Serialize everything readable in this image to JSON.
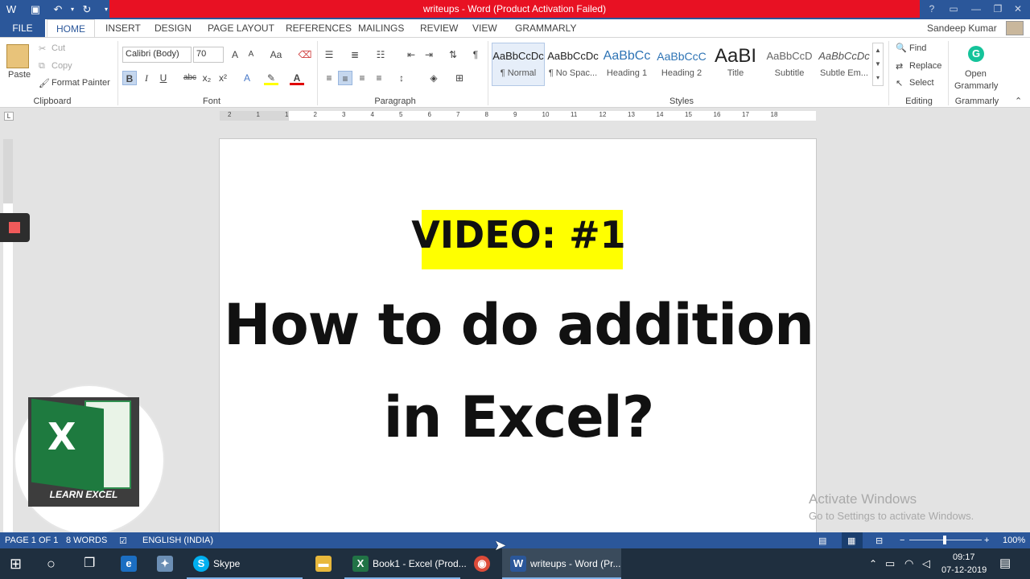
{
  "window": {
    "title": "writeups -  Word (Product Activation Failed)"
  },
  "tabs": [
    "FILE",
    "HOME",
    "INSERT",
    "DESIGN",
    "PAGE LAYOUT",
    "REFERENCES",
    "MAILINGS",
    "REVIEW",
    "VIEW",
    "GRAMMARLY"
  ],
  "user": {
    "name": "Sandeep Kumar"
  },
  "clipboard": {
    "paste": "Paste",
    "cut": "Cut",
    "copy": "Copy",
    "format_painter": "Format Painter",
    "label": "Clipboard"
  },
  "font": {
    "name": "Calibri (Body)",
    "size": "70",
    "bold": "B",
    "italic": "I",
    "underline": "U",
    "strike": "abc",
    "sub": "x₂",
    "sup": "x²",
    "label": "Font",
    "grow": "A",
    "shrink": "A",
    "case": "Aa"
  },
  "paragraph": {
    "label": "Paragraph"
  },
  "styles": {
    "label": "Styles",
    "items": [
      {
        "preview": "AaBbCcDc",
        "name": "¶ Normal"
      },
      {
        "preview": "AaBbCcDc",
        "name": "¶ No Spac..."
      },
      {
        "preview": "AaBbCc",
        "name": "Heading 1"
      },
      {
        "preview": "AaBbCcC",
        "name": "Heading 2"
      },
      {
        "preview": "AaBI",
        "name": "Title"
      },
      {
        "preview": "AaBbCcD",
        "name": "Subtitle"
      },
      {
        "preview": "AaBbCcDc",
        "name": "Subtle Em..."
      }
    ]
  },
  "editing": {
    "find": "Find",
    "replace": "Replace",
    "select": "Select",
    "label": "Editing"
  },
  "grammarly": {
    "open": "Open",
    "grammarly": "Grammarly",
    "label": "Grammarly"
  },
  "ruler": {
    "ticks": [
      "2",
      "1",
      "1",
      "2",
      "3",
      "4",
      "5",
      "6",
      "7",
      "8",
      "9",
      "10",
      "11",
      "12",
      "13",
      "14",
      "15",
      "16",
      "17",
      "18"
    ]
  },
  "document": {
    "line1": "VIDEO: #1",
    "line2": "How to do addition",
    "line3": "in Excel?"
  },
  "logo": {
    "letter": "X",
    "caption": "LEARN EXCEL"
  },
  "watermark": {
    "line1": "Activate Windows",
    "line2": "Go to Settings to activate Windows."
  },
  "status": {
    "page": "PAGE 1 OF 1",
    "words": "8 WORDS",
    "language": "ENGLISH (INDIA)",
    "zoom": "100%"
  },
  "taskbar": {
    "skype": "Skype",
    "excel": "Book1 - Excel (Prod...",
    "word": "writeups - Word (Pr...",
    "time": "09:17",
    "date": "07-12-2019"
  },
  "colors": {
    "brand": "#2b579a",
    "activation_bar": "#e81123",
    "highlight": "#ffff00",
    "excel_green": "#217346"
  }
}
